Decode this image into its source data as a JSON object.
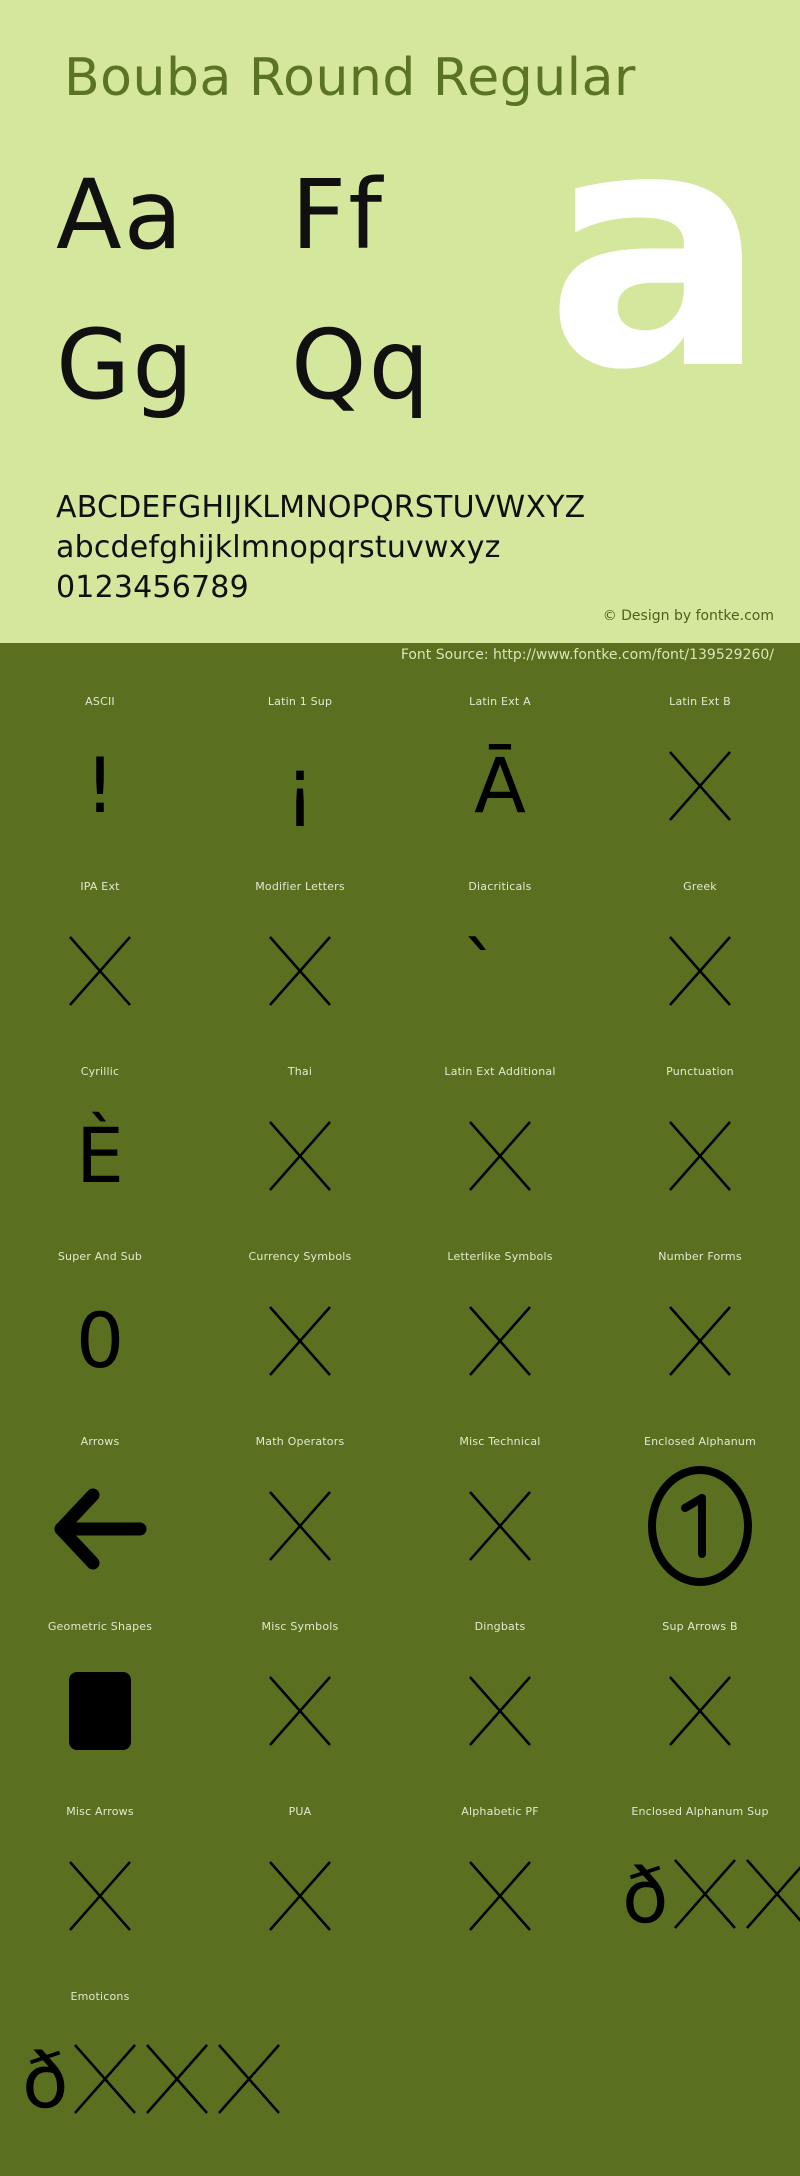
{
  "specimen": {
    "title": "Bouba Round Regular",
    "watermark_glyph": "a",
    "samples": [
      {
        "upper": "Aa",
        "lower": "Ff"
      },
      {
        "upper": "Gg",
        "lower": "Qq"
      }
    ],
    "alphabet_upper": "ABCDEFGHIJKLMNOPQRSTUVWXYZ",
    "alphabet_lower": "abcdefghijklmnopqrstuvwxyz",
    "digits": "0123456789",
    "copyright": "© Design by fontke.com",
    "source": "Font Source: http://www.fontke.com/font/139529260/",
    "colors": {
      "light_panel": "#d4e79c",
      "dark_panel": "#5a7020",
      "title": "#5a7324",
      "glyph": "#000000",
      "label": "#e0ead0",
      "watermark": "#ffffff"
    }
  },
  "blocks": [
    {
      "label": "ASCII",
      "glyph": "!",
      "kind": "glyph"
    },
    {
      "label": "Latin 1 Sup",
      "glyph": "¡",
      "kind": "glyph"
    },
    {
      "label": "Latin Ext A",
      "glyph": "Ā",
      "kind": "glyph"
    },
    {
      "label": "Latin Ext B",
      "glyph": "",
      "kind": "missing"
    },
    {
      "label": "IPA Ext",
      "glyph": "",
      "kind": "missing"
    },
    {
      "label": "Modifier Letters",
      "glyph": "",
      "kind": "missing"
    },
    {
      "label": "Diacriticals",
      "glyph": "̀",
      "kind": "glyph"
    },
    {
      "label": "Greek",
      "glyph": "",
      "kind": "missing"
    },
    {
      "label": "Cyrillic",
      "glyph": "È",
      "kind": "glyph"
    },
    {
      "label": "Thai",
      "glyph": "",
      "kind": "missing"
    },
    {
      "label": "Latin Ext Additional",
      "glyph": "",
      "kind": "missing"
    },
    {
      "label": "Punctuation",
      "glyph": "",
      "kind": "missing"
    },
    {
      "label": "Super And Sub",
      "glyph": "0",
      "kind": "glyph"
    },
    {
      "label": "Currency Symbols",
      "glyph": "",
      "kind": "missing"
    },
    {
      "label": "Letterlike Symbols",
      "glyph": "",
      "kind": "missing"
    },
    {
      "label": "Number Forms",
      "glyph": "",
      "kind": "missing"
    },
    {
      "label": "Arrows",
      "glyph": "←",
      "kind": "arrow"
    },
    {
      "label": "Math Operators",
      "glyph": "",
      "kind": "missing"
    },
    {
      "label": "Misc Technical",
      "glyph": "",
      "kind": "missing"
    },
    {
      "label": "Enclosed Alphanum",
      "glyph": "①",
      "kind": "circled"
    },
    {
      "label": "Geometric Shapes",
      "glyph": "■",
      "kind": "square"
    },
    {
      "label": "Misc Symbols",
      "glyph": "",
      "kind": "missing"
    },
    {
      "label": "Dingbats",
      "glyph": "",
      "kind": "missing"
    },
    {
      "label": "Sup Arrows B",
      "glyph": "",
      "kind": "missing"
    },
    {
      "label": "Misc Arrows",
      "glyph": "",
      "kind": "missing"
    },
    {
      "label": "PUA",
      "glyph": "",
      "kind": "missing"
    },
    {
      "label": "Alphabetic PF",
      "glyph": "",
      "kind": "missing"
    },
    {
      "label": "Enclosed Alphanum Sup",
      "glyph": "ð",
      "kind": "overflow2"
    },
    {
      "label": "Emoticons",
      "glyph": "ð",
      "kind": "overflow3"
    }
  ]
}
